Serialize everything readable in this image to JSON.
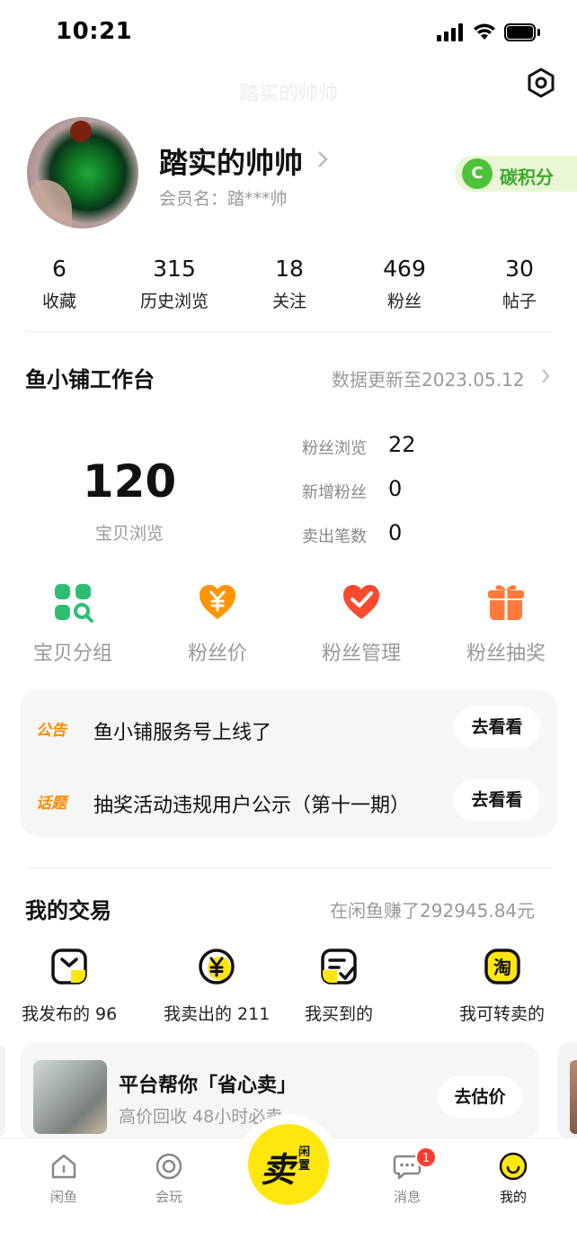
{
  "status_bar": {
    "time": "10:21"
  },
  "header": {
    "faded_title": "踏实的帅帅"
  },
  "profile": {
    "nickname": "踏实的帅帅",
    "member_name": "会员名：踏***帅",
    "carbon_icon_letter": "C",
    "carbon_label": "碳积分"
  },
  "stats": [
    {
      "value": "6",
      "label": "收藏"
    },
    {
      "value": "315",
      "label": "历史浏览"
    },
    {
      "value": "18",
      "label": "关注"
    },
    {
      "value": "469",
      "label": "粉丝"
    },
    {
      "value": "30",
      "label": "帖子"
    }
  ],
  "workbench": {
    "title": "鱼小铺工作台",
    "update_text": "数据更新至2023.05.12",
    "main_value": "120",
    "main_label": "宝贝浏览",
    "metrics": [
      {
        "label": "粉丝浏览",
        "value": "22"
      },
      {
        "label": "新增粉丝",
        "value": "0"
      },
      {
        "label": "卖出笔数",
        "value": "0"
      }
    ],
    "tools": [
      {
        "label": "宝贝分组",
        "icon": "grid-search-icon",
        "color": "#2dbe72"
      },
      {
        "label": "粉丝价",
        "icon": "yen-heart-icon",
        "color": "#ff9500"
      },
      {
        "label": "粉丝管理",
        "icon": "heart-check-icon",
        "color": "#ff4a2e"
      },
      {
        "label": "粉丝抽奖",
        "icon": "gift-box-icon",
        "color": "#ff7a3a"
      }
    ],
    "notices": [
      {
        "tag": "公告",
        "text": "鱼小铺服务号上线了",
        "button": "去看看"
      },
      {
        "tag": "话题",
        "text": "抽奖活动违规用户公示（第十一期）",
        "button": "去看看"
      }
    ]
  },
  "trade": {
    "title": "我的交易",
    "earned": "在闲鱼赚了292945.84元",
    "items": [
      {
        "label": "我发布的 96",
        "icon": "published-bag-icon"
      },
      {
        "label": "我卖出的 211",
        "icon": "sold-yen-icon"
      },
      {
        "label": "我买到的",
        "icon": "bought-check-icon"
      },
      {
        "label": "我可转卖的",
        "icon": "taobao-icon"
      }
    ],
    "promo": {
      "title": "平台帮你「省心卖」",
      "subtitle": "高价回收 48小时必卖",
      "button": "去估价"
    }
  },
  "tabbar": {
    "tabs": [
      {
        "label": "闲鱼",
        "icon": "home-icon",
        "active": false
      },
      {
        "label": "会玩",
        "icon": "circle-play-icon",
        "active": false
      },
      {
        "label": "消息",
        "icon": "message-icon",
        "active": false
      },
      {
        "label": "我的",
        "icon": "profile-face-icon",
        "active": true
      }
    ],
    "sell_main": "卖",
    "sell_side": "闲置",
    "message_badge": "1"
  },
  "colors": {
    "brand_yellow": "#ffe60f",
    "accent_orange": "#ff8a00",
    "carbon_green": "#4fc23c"
  }
}
